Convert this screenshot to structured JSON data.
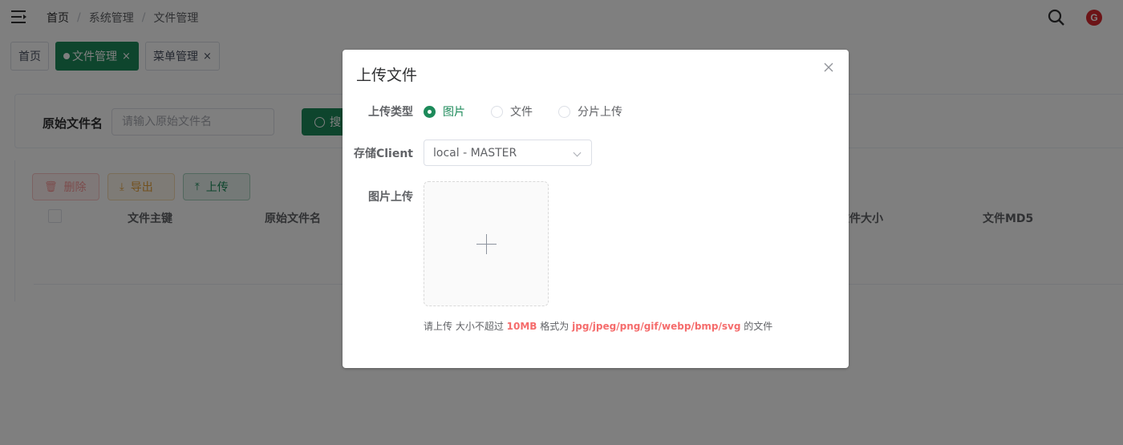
{
  "breadcrumb": [
    "首页",
    "系统管理",
    "文件管理"
  ],
  "header": {
    "avatar_letter": "G"
  },
  "tags": [
    {
      "label": "首页",
      "active": false
    },
    {
      "label": "文件管理",
      "active": true
    },
    {
      "label": "菜单管理",
      "active": false
    }
  ],
  "search": {
    "label": "原始文件名",
    "placeholder": "请输入原始文件名",
    "button": "搜"
  },
  "actions": {
    "delete": "删除",
    "export": "导出",
    "upload": "上传"
  },
  "table": {
    "columns": [
      "文件主键",
      "原始文件名",
      "文件大小",
      "文件MD5"
    ]
  },
  "dialog": {
    "title": "上传文件",
    "type_label": "上传类型",
    "type_options": [
      "图片",
      "文件",
      "分片上传"
    ],
    "client_label": "存储Client",
    "client_value": "local - MASTER",
    "image_label": "图片上传",
    "tip": {
      "pre": "请上传 大小不超过",
      "size": "10MB",
      "mid": "格式为",
      "formats": "jpg/jpeg/png/gif/webp/bmp/svg",
      "post": "的文件"
    }
  },
  "colors": {
    "primary": "#1d8a5a",
    "danger": "#f56c6c",
    "warning": "#e6a23c"
  }
}
